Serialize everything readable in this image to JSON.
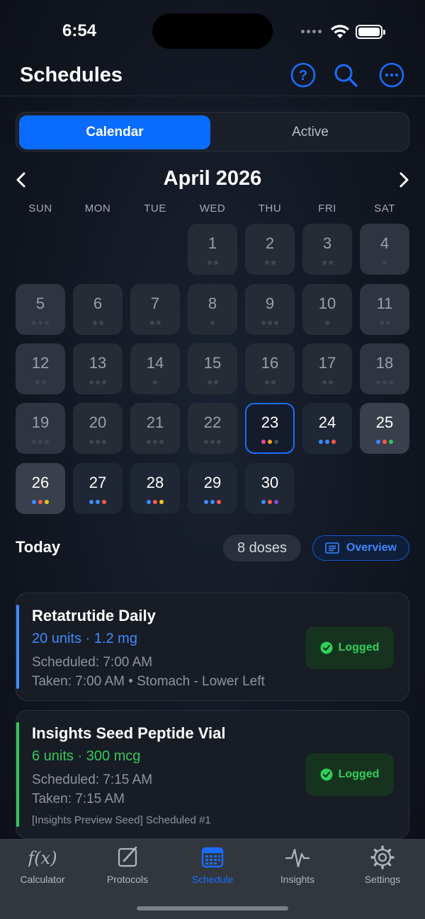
{
  "status": {
    "time": "6:54"
  },
  "header": {
    "title": "Schedules"
  },
  "segments": {
    "calendar": "Calendar",
    "active": "Active",
    "selected": "Calendar"
  },
  "calendar": {
    "month_title": "April 2026",
    "weekdays": [
      "SUN",
      "MON",
      "TUE",
      "WED",
      "THU",
      "FRI",
      "SAT"
    ],
    "today": 23,
    "days": [
      {
        "day": 1,
        "dots": [
          "gray",
          "gray"
        ]
      },
      {
        "day": 2,
        "dots": [
          "gray",
          "gray"
        ]
      },
      {
        "day": 3,
        "dots": [
          "gray",
          "gray"
        ]
      },
      {
        "day": 4,
        "dots": [
          "gray"
        ]
      },
      {
        "day": 5,
        "dots": [
          "gray",
          "gray",
          "gray"
        ]
      },
      {
        "day": 6,
        "dots": [
          "gray",
          "gray"
        ]
      },
      {
        "day": 7,
        "dots": [
          "gray",
          "gray"
        ]
      },
      {
        "day": 8,
        "dots": [
          "gray"
        ]
      },
      {
        "day": 9,
        "dots": [
          "gray",
          "gray",
          "gray"
        ]
      },
      {
        "day": 10,
        "dots": [
          "gray"
        ]
      },
      {
        "day": 11,
        "dots": [
          "gray",
          "gray"
        ]
      },
      {
        "day": 12,
        "dots": [
          "gray",
          "gray"
        ]
      },
      {
        "day": 13,
        "dots": [
          "gray",
          "gray",
          "gray"
        ]
      },
      {
        "day": 14,
        "dots": [
          "gray"
        ]
      },
      {
        "day": 15,
        "dots": [
          "gray",
          "gray"
        ]
      },
      {
        "day": 16,
        "dots": [
          "gray",
          "gray"
        ]
      },
      {
        "day": 17,
        "dots": [
          "gray",
          "gray"
        ]
      },
      {
        "day": 18,
        "dots": [
          "gray",
          "gray",
          "gray"
        ]
      },
      {
        "day": 19,
        "dots": [
          "gray",
          "gray",
          "gray"
        ]
      },
      {
        "day": 20,
        "dots": [
          "gray",
          "gray",
          "gray"
        ]
      },
      {
        "day": 21,
        "dots": [
          "gray",
          "gray",
          "gray"
        ]
      },
      {
        "day": 22,
        "dots": [
          "gray",
          "gray",
          "gray"
        ]
      },
      {
        "day": 23,
        "dots": [
          "#e8489a",
          "#f0a020",
          "#4a505a"
        ]
      },
      {
        "day": 24,
        "dots": [
          "#3d8bff",
          "#3d8bff",
          "#ff5a4a"
        ]
      },
      {
        "day": 25,
        "dots": [
          "#3d8bff",
          "#ff5a4a",
          "#35c759"
        ]
      },
      {
        "day": 26,
        "dots": [
          "#3d8bff",
          "#ff5a4a",
          "#f5c518"
        ]
      },
      {
        "day": 27,
        "dots": [
          "#3d8bff",
          "#3d8bff",
          "#ff5a4a"
        ]
      },
      {
        "day": 28,
        "dots": [
          "#3d8bff",
          "#ff5a4a",
          "#f5c518"
        ]
      },
      {
        "day": 29,
        "dots": [
          "#3d8bff",
          "#3d8bff",
          "#ff5a4a"
        ]
      },
      {
        "day": 30,
        "dots": [
          "#3d8bff",
          "#ff5a4a",
          "#8a4bd6"
        ]
      }
    ]
  },
  "today_section": {
    "label": "Today",
    "doses": "8 doses",
    "overview": "Overview"
  },
  "doses": [
    {
      "name": "Retatrutide Daily",
      "amount": "20 units · 1.2 mg",
      "amount_color": "#3d8bff",
      "accent": "#3d8bff",
      "scheduled": "Scheduled: 7:00 AM",
      "taken": "Taken: 7:00 AM • Stomach - Lower Left",
      "note": "",
      "status": "Logged"
    },
    {
      "name": "Insights Seed Peptide Vial",
      "amount": "6 units · 300 mcg",
      "amount_color": "#35c759",
      "accent": "#35c759",
      "scheduled": "Scheduled: 7:15 AM",
      "taken": "Taken: 7:15 AM",
      "note": "[Insights Preview Seed] Scheduled #1",
      "status": "Logged"
    }
  ],
  "tabs": [
    {
      "label": "Calculator",
      "icon": "function-icon"
    },
    {
      "label": "Protocols",
      "icon": "edit-square-icon"
    },
    {
      "label": "Schedule",
      "icon": "calendar-icon"
    },
    {
      "label": "Insights",
      "icon": "waveform-icon"
    },
    {
      "label": "Settings",
      "icon": "gear-icon"
    }
  ],
  "selected_tab": "Schedule"
}
